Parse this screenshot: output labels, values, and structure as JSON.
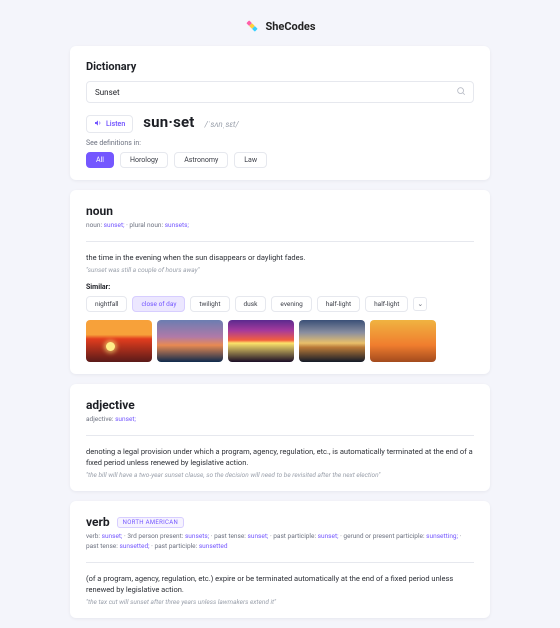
{
  "brand": {
    "name": "SheCodes"
  },
  "header": {
    "title": "Dictionary",
    "search_value": "Sunset",
    "search_placeholder": "",
    "listen_label": "Listen",
    "word_display": "sun·set",
    "phonetic": "/ˈsʌnˌsɛt/",
    "see_label": "See definitions in:",
    "filters": [
      "All",
      "Horology",
      "Astronomy",
      "Law"
    ]
  },
  "noun": {
    "pos": "noun",
    "forms_prefix_1": "noun: ",
    "forms_word_1": "sunset;",
    "forms_sep": "  ·  plural noun: ",
    "forms_word_2": "sunsets;",
    "definition": "the time in the evening when the sun disappears or daylight fades.",
    "example": "\"sunset was still a couple of hours away\"",
    "similar_label": "Similar:",
    "similars": [
      "nightfall",
      "close of day",
      "twilight",
      "dusk",
      "evening",
      "half-light",
      "half-light"
    ],
    "expand_glyph": "⌄"
  },
  "adjective": {
    "pos": "adjective",
    "forms_prefix": "adjective: ",
    "forms_word": "sunset;",
    "definition": "denoting a legal provision under which a program, agency, regulation, etc., is automatically terminated at the end of a fixed period unless renewed by legislative action.",
    "example": "\"the bill will have a two-year sunset clause, so the decision will need to be revisited after the next election\""
  },
  "verb": {
    "pos": "verb",
    "badge": "NORTH AMERICAN",
    "forms_html_parts": {
      "p1": "verb: ",
      "w1": "sunset;",
      "p2": "  ·  3rd person present: ",
      "w2": "sunsets;",
      "p3": "  ·  past tense: ",
      "w3": "sunset;",
      "p4": "  ·  past participle: ",
      "w4": "sunset;",
      "p5": "  ·  gerund or present participle: ",
      "w5": "sunsetting;",
      "p6": "  ·  past tense: ",
      "w6": "sunsetted;",
      "p7": "  ·  past participle: ",
      "w7": "sunsetted"
    },
    "definition": "(of a program, agency, regulation, etc.) expire or be terminated automatically at the end of a fixed period unless renewed by legislative action.",
    "example": "\"the tax cut will sunset after three years unless lawmakers extend it\""
  }
}
